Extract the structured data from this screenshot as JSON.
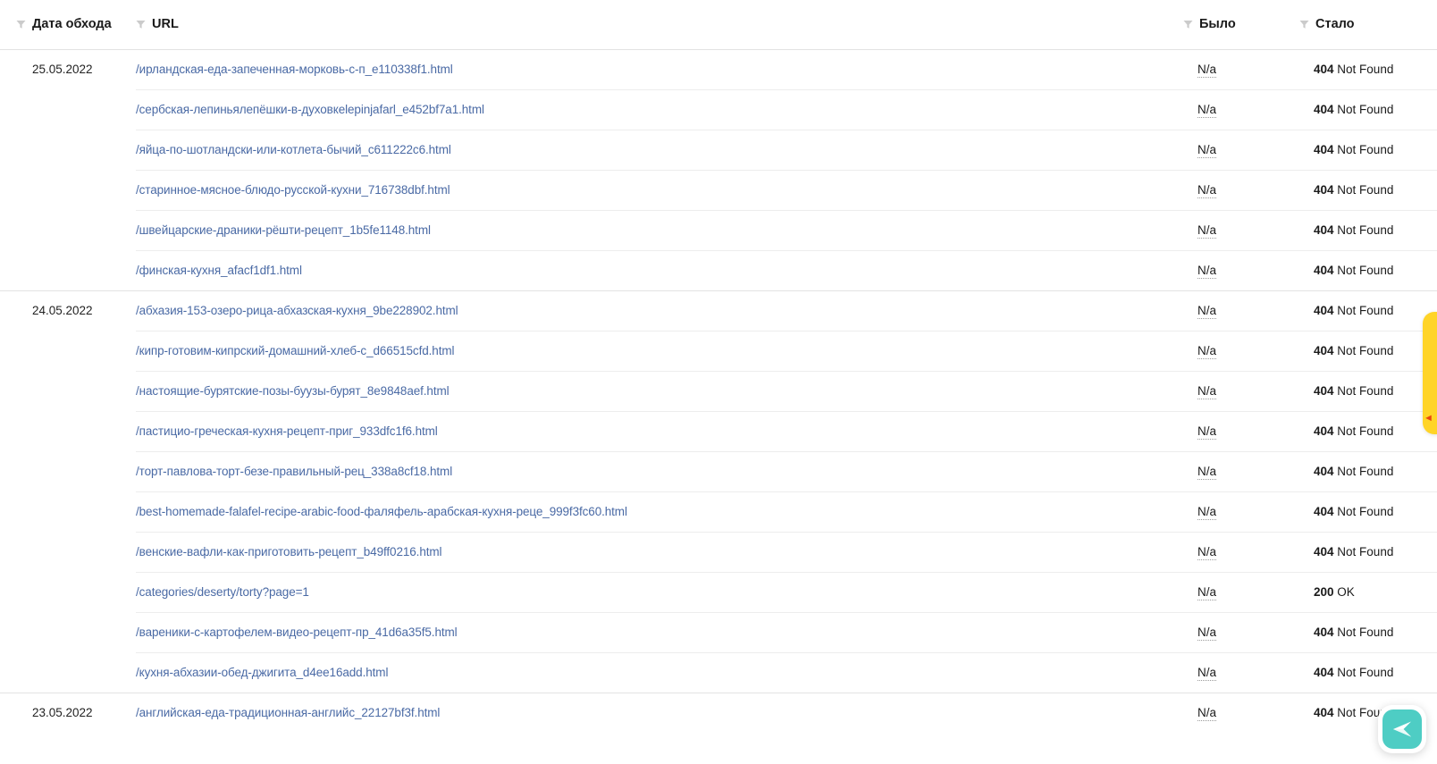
{
  "table": {
    "columns": [
      {
        "key": "date",
        "label": "Дата обхода",
        "filter_icon": "funnel-icon"
      },
      {
        "key": "url",
        "label": "URL",
        "filter_icon": "funnel-icon"
      },
      {
        "key": "was",
        "label": "Было",
        "filter_icon": "funnel-icon"
      },
      {
        "key": "now",
        "label": "Стало",
        "filter_icon": "funnel-icon"
      }
    ],
    "rows": [
      {
        "date": "25.05.2022",
        "group_first": true,
        "url": "/ирландская-еда-запеченная-морковь-с-п_e110338f1.html",
        "was": "N/a",
        "code": "404",
        "code_text": "Not Found"
      },
      {
        "date": "",
        "group_first": false,
        "url": "/сербская-лепиньялепёшки-в-духовкеlepinjafarl_e452bf7a1.html",
        "was": "N/a",
        "code": "404",
        "code_text": "Not Found"
      },
      {
        "date": "",
        "group_first": false,
        "url": "/яйца-по-шотландски-или-котлета-бычий_c611222c6.html",
        "was": "N/a",
        "code": "404",
        "code_text": "Not Found"
      },
      {
        "date": "",
        "group_first": false,
        "url": "/старинное-мясное-блюдо-русской-кухни_716738dbf.html",
        "was": "N/a",
        "code": "404",
        "code_text": "Not Found"
      },
      {
        "date": "",
        "group_first": false,
        "url": "/швейцарские-драники-рёшти-рецепт_1b5fe1148.html",
        "was": "N/a",
        "code": "404",
        "code_text": "Not Found"
      },
      {
        "date": "",
        "group_first": false,
        "url": "/финская-кухня_afacf1df1.html",
        "was": "N/a",
        "code": "404",
        "code_text": "Not Found"
      },
      {
        "date": "24.05.2022",
        "group_first": true,
        "url": "/абхазия-153-озеро-рица-абхазская-кухня_9be228902.html",
        "was": "N/a",
        "code": "404",
        "code_text": "Not Found"
      },
      {
        "date": "",
        "group_first": false,
        "url": "/кипр-готовим-кипрский-домашний-хлеб-с_d66515cfd.html",
        "was": "N/a",
        "code": "404",
        "code_text": "Not Found"
      },
      {
        "date": "",
        "group_first": false,
        "url": "/настоящие-бурятские-позы-буузы-бурят_8e9848aef.html",
        "was": "N/a",
        "code": "404",
        "code_text": "Not Found"
      },
      {
        "date": "",
        "group_first": false,
        "url": "/пастицио-греческая-кухня-рецепт-приг_933dfc1f6.html",
        "was": "N/a",
        "code": "404",
        "code_text": "Not Found"
      },
      {
        "date": "",
        "group_first": false,
        "url": "/торт-павлова-торт-безе-правильный-рец_338a8cf18.html",
        "was": "N/a",
        "code": "404",
        "code_text": "Not Found"
      },
      {
        "date": "",
        "group_first": false,
        "url": "/best-homemade-falafel-recipe-arabic-food-фаляфель-арабская-кухня-реце_999f3fc60.html",
        "was": "N/a",
        "code": "404",
        "code_text": "Not Found"
      },
      {
        "date": "",
        "group_first": false,
        "url": "/венские-вафли-как-приготовить-рецепт_b49ff0216.html",
        "was": "N/a",
        "code": "404",
        "code_text": "Not Found"
      },
      {
        "date": "",
        "group_first": false,
        "url": "/categories/deserty/torty?page=1",
        "was": "N/a",
        "code": "200",
        "code_text": "OK"
      },
      {
        "date": "",
        "group_first": false,
        "url": "/вареники-с-картофелем-видео-рецепт-пр_41d6a35f5.html",
        "was": "N/a",
        "code": "404",
        "code_text": "Not Found"
      },
      {
        "date": "",
        "group_first": false,
        "url": "/кухня-абхазии-обед-джигита_d4ee16add.html",
        "was": "N/a",
        "code": "404",
        "code_text": "Not Found"
      },
      {
        "date": "23.05.2022",
        "group_first": true,
        "url": "/английская-еда-традиционная-английс_22127bf3f.html",
        "was": "N/a",
        "code": "404",
        "code_text": "Not Found"
      }
    ]
  },
  "widgets": {
    "feedback_tab": {
      "name": "feedback-tab",
      "color": "#ffd428"
    },
    "chat_button": {
      "name": "chat-button",
      "icon": "send-icon",
      "color": "#4ecdc4"
    }
  },
  "colors": {
    "link": "#4a6aa5",
    "text": "#1a1a1a",
    "row_border": "#ededed",
    "group_border": "#e3e3e3",
    "accent_yellow": "#ffd428",
    "accent_teal": "#4ecdc4"
  }
}
